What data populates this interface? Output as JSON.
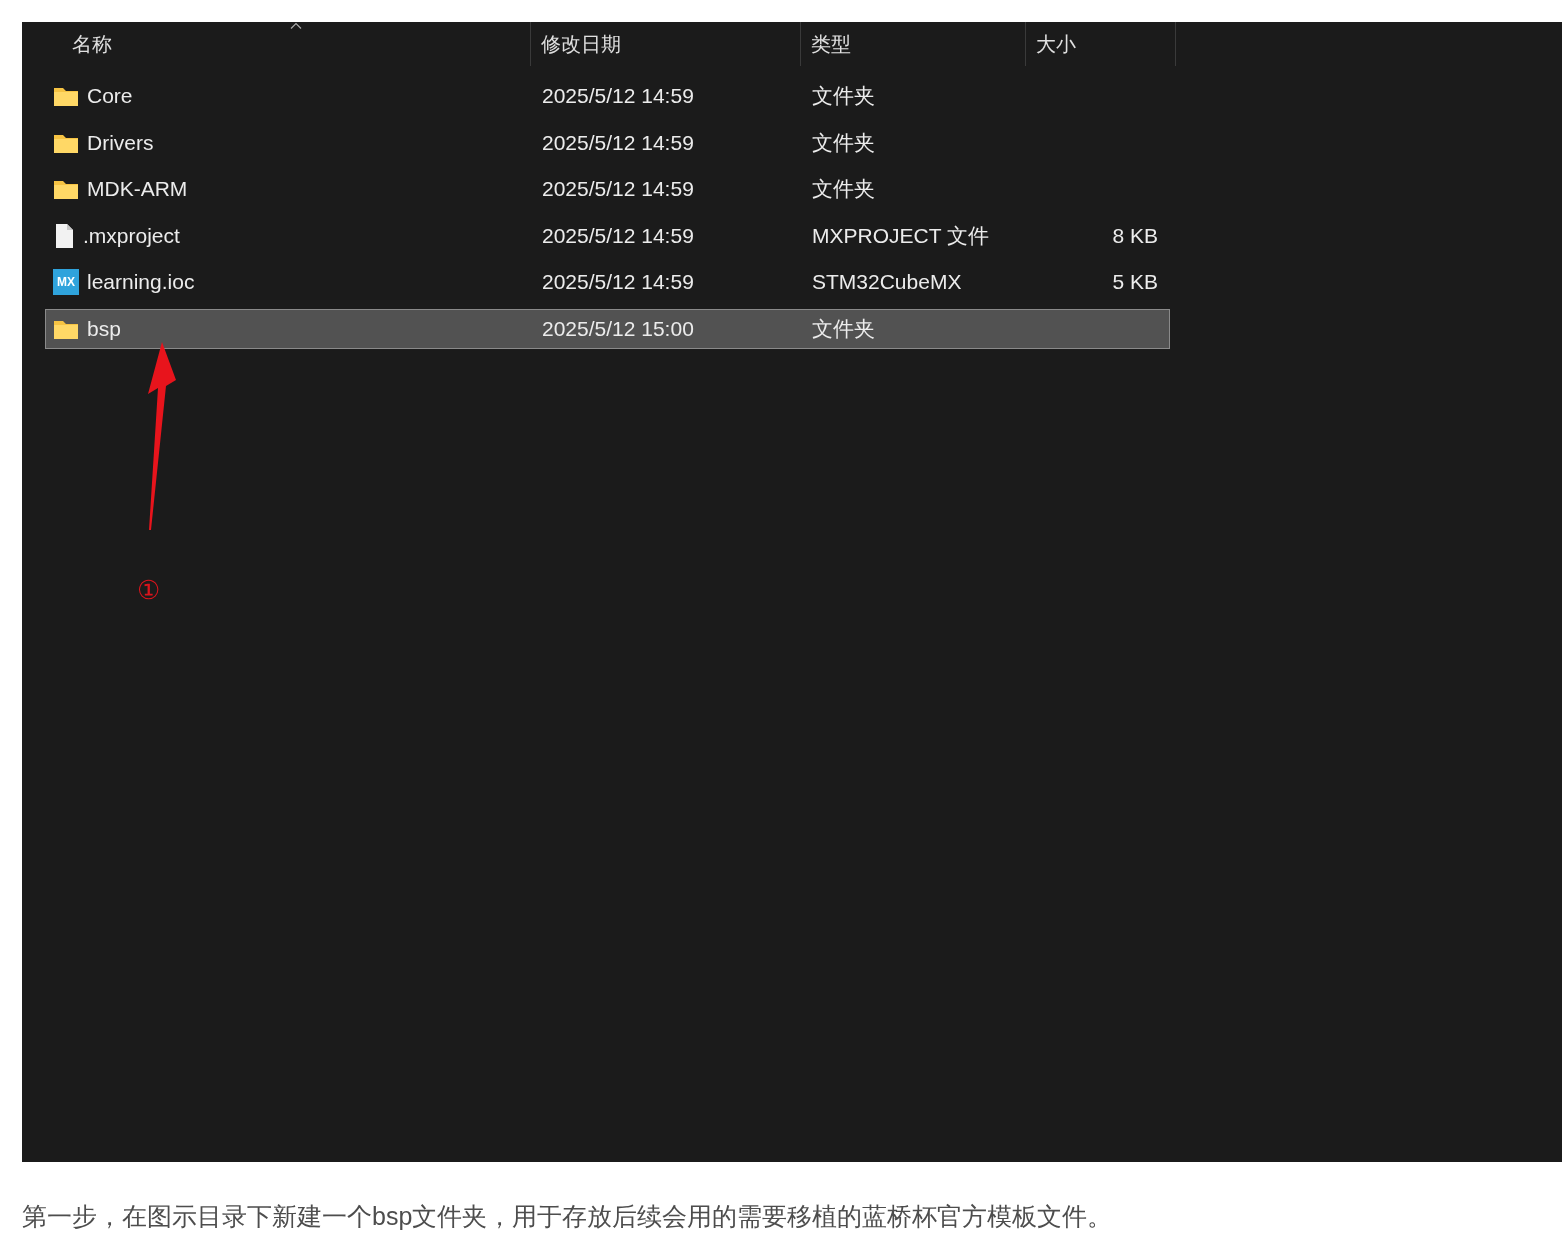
{
  "explorer": {
    "columns": [
      {
        "label": "名称",
        "sorted": true
      },
      {
        "label": "修改日期",
        "sorted": false
      },
      {
        "label": "类型",
        "sorted": false
      },
      {
        "label": "大小",
        "sorted": false
      }
    ],
    "rows": [
      {
        "kind": "folder",
        "name": "Core",
        "date": "2025/5/12 14:59",
        "type": "文件夹",
        "selected": false
      },
      {
        "kind": "folder",
        "name": "Drivers",
        "date": "2025/5/12 14:59",
        "type": "文件夹",
        "selected": false
      },
      {
        "kind": "folder",
        "name": "MDK-ARM",
        "date": "2025/5/12 14:59",
        "type": "文件夹",
        "selected": false
      },
      {
        "kind": "file",
        "name": ".mxproject",
        "date": "2025/5/12 14:59",
        "type": "MXPROJECT 文件",
        "size": "8 KB",
        "selected": false
      },
      {
        "kind": "mx",
        "icon_text": "MX",
        "name": "learning.ioc",
        "date": "2025/5/12 14:59",
        "type": "STM32CubeMX",
        "size": "5 KB",
        "selected": false
      },
      {
        "kind": "folder",
        "name": "bsp",
        "date": "2025/5/12 15:00",
        "type": "文件夹",
        "selected": true
      }
    ]
  },
  "annotation": {
    "marker": "①"
  },
  "caption": "第一步，在图示目录下新建一个bsp文件夹，用于存放后续会用的需要移植的蓝桥杯官方模板文件。"
}
